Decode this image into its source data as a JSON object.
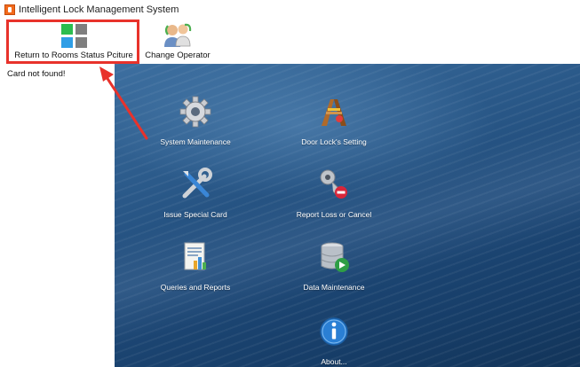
{
  "window": {
    "title": "Intelligent Lock Management System",
    "icon": "app-lock-icon"
  },
  "toolbar": {
    "rooms_status_label": "Return to Rooms Status Pciture",
    "rooms_status_icon": "room-grid-icon",
    "change_operator_label": "Change Operator",
    "change_operator_icon": "operator-icon",
    "grid_colors": [
      "#2bbd4f",
      "#7f7f7f",
      "#2f9ee6",
      "#7f7f7f"
    ]
  },
  "status": {
    "message": "Card not found!"
  },
  "annotation": {
    "highlight_color": "#e8322b"
  },
  "menu": [
    {
      "label": "System Maintenance",
      "icon": "gear-icon"
    },
    {
      "label": "Door Lock's Setting",
      "icon": "lock-setting-icon"
    },
    {
      "label": "Issue Special Card",
      "icon": "tools-icon"
    },
    {
      "label": "Report Loss or Cancel",
      "icon": "key-cancel-icon"
    },
    {
      "label": "Queries and Reports",
      "icon": "report-icon"
    },
    {
      "label": "Data Maintenance",
      "icon": "database-icon"
    },
    {
      "label": "About...",
      "icon": "info-icon"
    }
  ]
}
